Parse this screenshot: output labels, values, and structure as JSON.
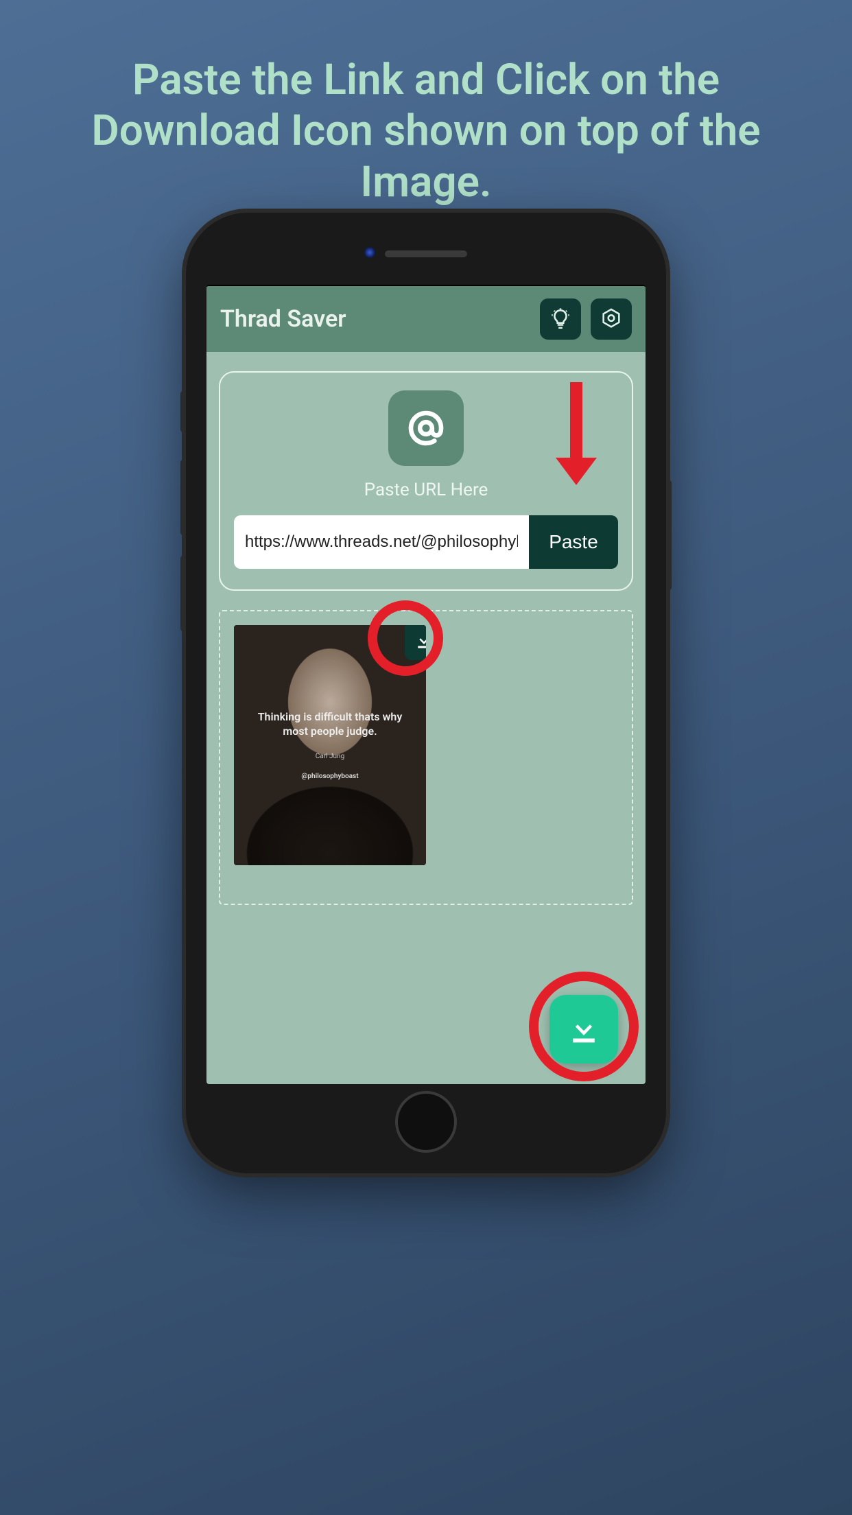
{
  "promo": {
    "heading": "Paste the Link and Click on the Download Icon shown on top of the Image."
  },
  "app": {
    "title": "Thrad Saver"
  },
  "card": {
    "label": "Paste URL Here",
    "url_value": "https://www.threads.net/@philosophyboa",
    "paste_label": "Paste"
  },
  "thumb": {
    "quote": "Thinking is difficult thats why most people judge.",
    "author": "Carl Jung",
    "handle": "@philosophyboast"
  },
  "icons": {
    "lightbulb": "lightbulb-icon",
    "settings": "settings-icon",
    "at": "at-icon",
    "download": "download-icon"
  },
  "colors": {
    "accent_dark": "#0d3b34",
    "accent_green": "#1ec996",
    "highlight_red": "#e3202a"
  }
}
